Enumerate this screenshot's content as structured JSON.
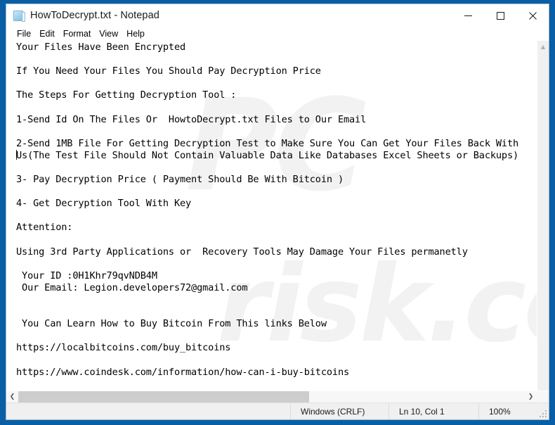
{
  "window": {
    "title": "HowToDecrypt.txt - Notepad",
    "icon": "notepad-icon",
    "controls": {
      "minimize": "minimize-icon",
      "maximize": "maximize-icon",
      "close": "close-icon"
    }
  },
  "menu": {
    "items": [
      {
        "label": "File"
      },
      {
        "label": "Edit"
      },
      {
        "label": "Format"
      },
      {
        "label": "View"
      },
      {
        "label": "Help"
      }
    ]
  },
  "document": {
    "lines_before_caret": "Your Files Have Been Encrypted\n\nIf You Need Your Files You Should Pay Decryption Price\n\nThe Steps For Getting Decryption Tool :\n\n1-Send Id On The Files Or  HowtoDecrypt.txt Files to Our Email\n\n2-Send 1MB File For Getting Decryption Test to Make Sure You Can Get Your Files Back With\n",
    "lines_after_caret": "Us(The Test File Should Not Contain Valuable Data Like Databases Excel Sheets or Backups)\n\n3- Pay Decryption Price ( Payment Should Be With Bitcoin )\n\n4- Get Decryption Tool With Key\n\nAttention:\n\nUsing 3rd Party Applications or  Recovery Tools May Damage Your Files permanetly\n\n Your ID :0H1Khr79qvNDB4M\n Our Email: Legion.developers72@gmail.com\n\n\n You Can Learn How to Buy Bitcoin From This links Below\n\nhttps://localbitcoins.com/buy_bitcoins\n\nhttps://www.coindesk.com/information/how-can-i-buy-bitcoins",
    "full_text": "Your Files Have Been Encrypted\n\nIf You Need Your Files You Should Pay Decryption Price\n\nThe Steps For Getting Decryption Tool :\n\n1-Send Id On The Files Or  HowtoDecrypt.txt Files to Our Email\n\n2-Send 1MB File For Getting Decryption Test to Make Sure You Can Get Your Files Back With\nUs(The Test File Should Not Contain Valuable Data Like Databases Excel Sheets or Backups)\n\n3- Pay Decryption Price ( Payment Should Be With Bitcoin )\n\n4- Get Decryption Tool With Key\n\nAttention:\n\nUsing 3rd Party Applications or  Recovery Tools May Damage Your Files permanetly\n\n Your ID :0H1Khr79qvNDB4M\n Our Email: Legion.developers72@gmail.com\n\n\n You Can Learn How to Buy Bitcoin From This links Below\n\nhttps://localbitcoins.com/buy_bitcoins\n\nhttps://www.coindesk.com/information/how-can-i-buy-bitcoins",
    "victim_id": "0H1Khr79qvNDB4M",
    "contact_email": "Legion.developers72@gmail.com",
    "links": [
      "https://localbitcoins.com/buy_bitcoins",
      "https://www.coindesk.com/information/how-can-i-buy-bitcoins"
    ]
  },
  "watermark": {
    "line1": "PC",
    "line2": "risk.com"
  },
  "scrollbars": {
    "up_arrow": "▲",
    "left_arrow": "❮",
    "right_arrow": "❯"
  },
  "statusbar": {
    "encoding": "Windows (CRLF)",
    "position": "Ln 10, Col 1",
    "zoom": "100%"
  },
  "colors": {
    "desktop_blue": "#0a5ea6",
    "window_bg": "#ffffff",
    "statusbar_bg": "#f0f0f0",
    "scroll_thumb": "#cdcdcd"
  }
}
